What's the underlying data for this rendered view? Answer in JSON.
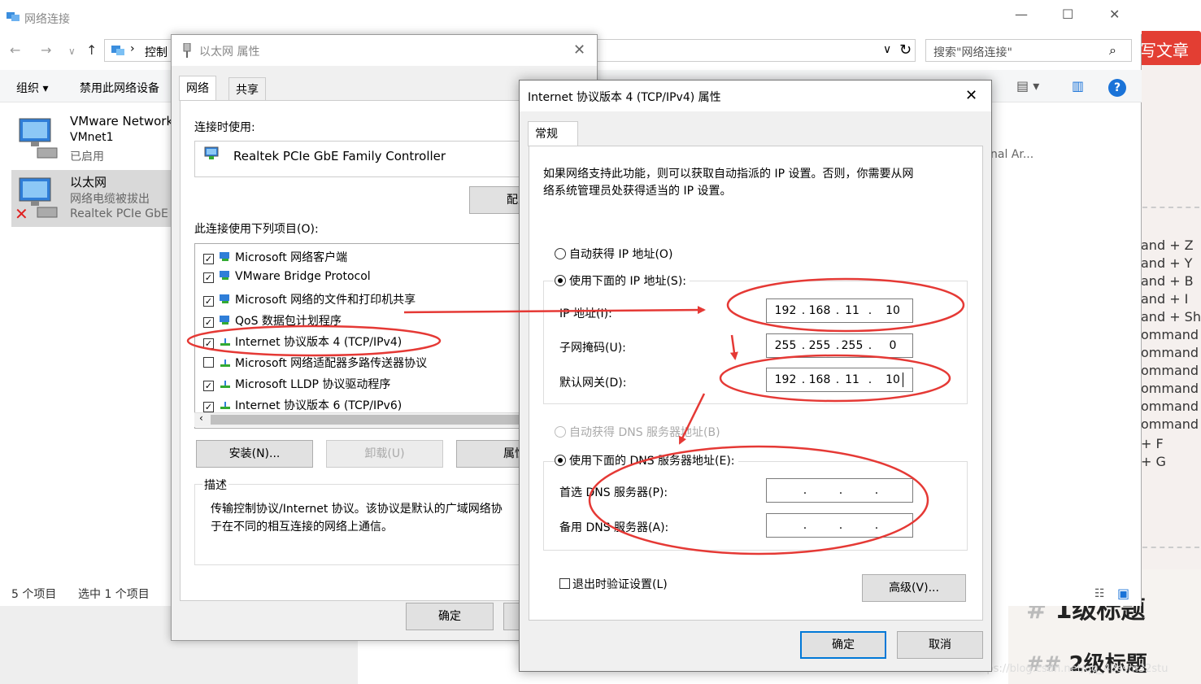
{
  "background": {
    "red_button": "写文章",
    "side_lines": [
      "and + Z",
      "and + Y",
      "and + B",
      "and + I",
      "and + Sh",
      "ommand",
      "ommand",
      "ommand",
      "ommand",
      "ommand",
      "ommand",
      "+ F",
      "+ G"
    ],
    "h1_hash": "#",
    "h1_text": "1级标题",
    "h2_hash": "##",
    "h2_text": "2级标题",
    "watermark": "https://blog.csdn.net/qq_43ssm32stu"
  },
  "explorer": {
    "title": "网络连接",
    "breadcrumb": "控制",
    "search_placeholder": "搜索\"网络连接\"",
    "cmd_organize": "组织 ▾",
    "cmd_disable": "禁用此网络设备",
    "adapters": [
      {
        "name": "VMware Network",
        "line2": "VMnet1",
        "line3": "已启用"
      },
      {
        "name": "以太网",
        "line2": "网络电缆被拔出",
        "line3": "Realtek PCIe GbE"
      }
    ],
    "right_text": "nal Ar...",
    "status_count": "5 个项目",
    "status_selected": "选中 1 个项目"
  },
  "ethernet_dialog": {
    "title": "以太网 属性",
    "tabs": [
      "网络",
      "共享"
    ],
    "connect_using_label": "连接时使用:",
    "adapter_name": "Realtek PCIe GbE Family Controller",
    "configure_button": "配置",
    "items_label": "此连接使用下列项目(O):",
    "items": [
      {
        "label": "Microsoft 网络客户端",
        "checked": true,
        "icon": "network-client-icon"
      },
      {
        "label": "VMware Bridge Protocol",
        "checked": true,
        "icon": "network-client-icon"
      },
      {
        "label": "Microsoft 网络的文件和打印机共享",
        "checked": true,
        "icon": "network-client-icon"
      },
      {
        "label": "QoS 数据包计划程序",
        "checked": true,
        "icon": "network-client-icon"
      },
      {
        "label": "Internet 协议版本 4 (TCP/IPv4)",
        "checked": true,
        "icon": "protocol-icon"
      },
      {
        "label": "Microsoft 网络适配器多路传送器协议",
        "checked": false,
        "icon": "protocol-icon"
      },
      {
        "label": "Microsoft LLDP 协议驱动程序",
        "checked": true,
        "icon": "protocol-icon"
      },
      {
        "label": "Internet 协议版本 6 (TCP/IPv6)",
        "checked": true,
        "icon": "protocol-icon"
      }
    ],
    "install_button": "安装(N)...",
    "uninstall_button": "卸载(U)",
    "properties_button": "属性",
    "description_label": "描述",
    "description_text": "传输控制协议/Internet 协议。该协议是默认的广域网络协议，用于在不同的相互连接的网络上通信。",
    "description_line1": "传输控制协议/Internet 协议。该协议是默认的广域网络协",
    "description_line2": "于在不同的相互连接的网络上通信。",
    "ok_button": "确定"
  },
  "ipv4_dialog": {
    "title": "Internet 协议版本 4 (TCP/IPv4) 属性",
    "tab": "常规",
    "intro_line1": "如果网络支持此功能，则可以获取自动指派的 IP 设置。否则，你需要从网",
    "intro_line2": "络系统管理员处获得适当的 IP 设置。",
    "auto_ip": "自动获得 IP 地址(O)",
    "manual_ip": "使用下面的 IP 地址(S):",
    "ip_label": "IP 地址(I):",
    "mask_label": "子网掩码(U):",
    "gateway_label": "默认网关(D):",
    "ip": [
      "192",
      "168",
      "11",
      "10"
    ],
    "mask": [
      "255",
      "255",
      "255",
      "0"
    ],
    "gateway": [
      "192",
      "168",
      "11",
      "10"
    ],
    "auto_dns": "自动获得 DNS 服务器地址(B)",
    "manual_dns": "使用下面的 DNS 服务器地址(E):",
    "dns1_label": "首选 DNS 服务器(P):",
    "dns2_label": "备用 DNS 服务器(A):",
    "dns1": [
      "",
      "",
      "",
      ""
    ],
    "dns2": [
      "",
      "",
      "",
      ""
    ],
    "validate_label": "退出时验证设置(L)",
    "advanced_button": "高级(V)...",
    "ok_button": "确定",
    "cancel_button": "取消",
    "manual_ip_selected": true,
    "manual_dns_selected": true
  },
  "colors": {
    "annotation_red": "#e53935",
    "focus_blue": "#0078d7",
    "brand_red": "#e33e33"
  }
}
